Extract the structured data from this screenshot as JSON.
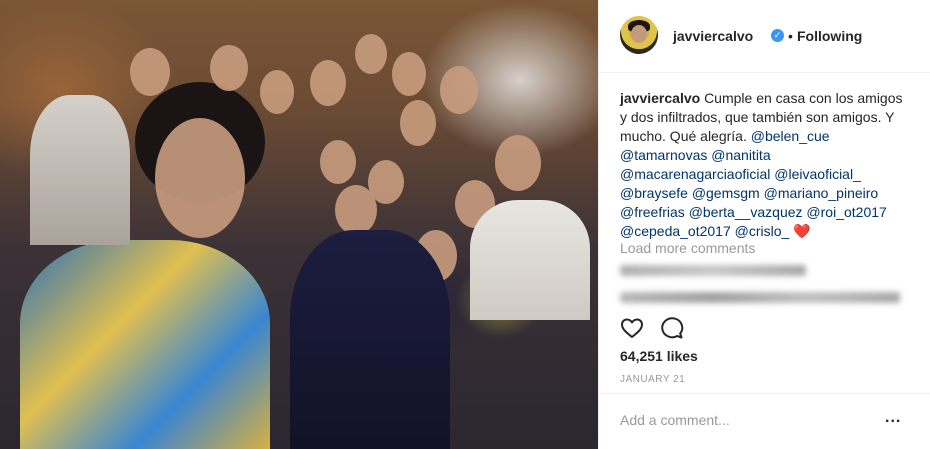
{
  "post": {
    "photo_alt": "",
    "header": {
      "username": "javviercalvo",
      "verified_icon": "verified-badge-icon",
      "separator": "•",
      "follow_status": "Following"
    },
    "caption": {
      "username": "javviercalvo",
      "text": "Cumple en casa con los amigos y dos infiltrados, que también son amigos. Y mucho. Qué alegría.",
      "mentions": [
        "@belen_cue",
        "@tamarnovas",
        "@nanitita",
        "@macarenagarciaoficial",
        "@leivaoficial_",
        "@braysefe",
        "@gemsgm",
        "@mariano_pineiro",
        "@freefrias",
        "@berta__vazquez",
        "@roi_ot2017",
        "@cepeda_ot2017",
        "@crislo_"
      ],
      "emoji": "❤️"
    },
    "load_more": "Load more comments",
    "actions": {
      "like_icon": "heart-outline-icon",
      "comment_icon": "comment-bubble-icon"
    },
    "likes": "64,251 likes",
    "date": "JANUARY 21",
    "comment_placeholder": "Add a comment...",
    "more_options": "..."
  },
  "colors": {
    "link": "#003569",
    "muted": "#999999",
    "text": "#262626",
    "verified": "#3897f0",
    "heart": "#ed1c24"
  }
}
